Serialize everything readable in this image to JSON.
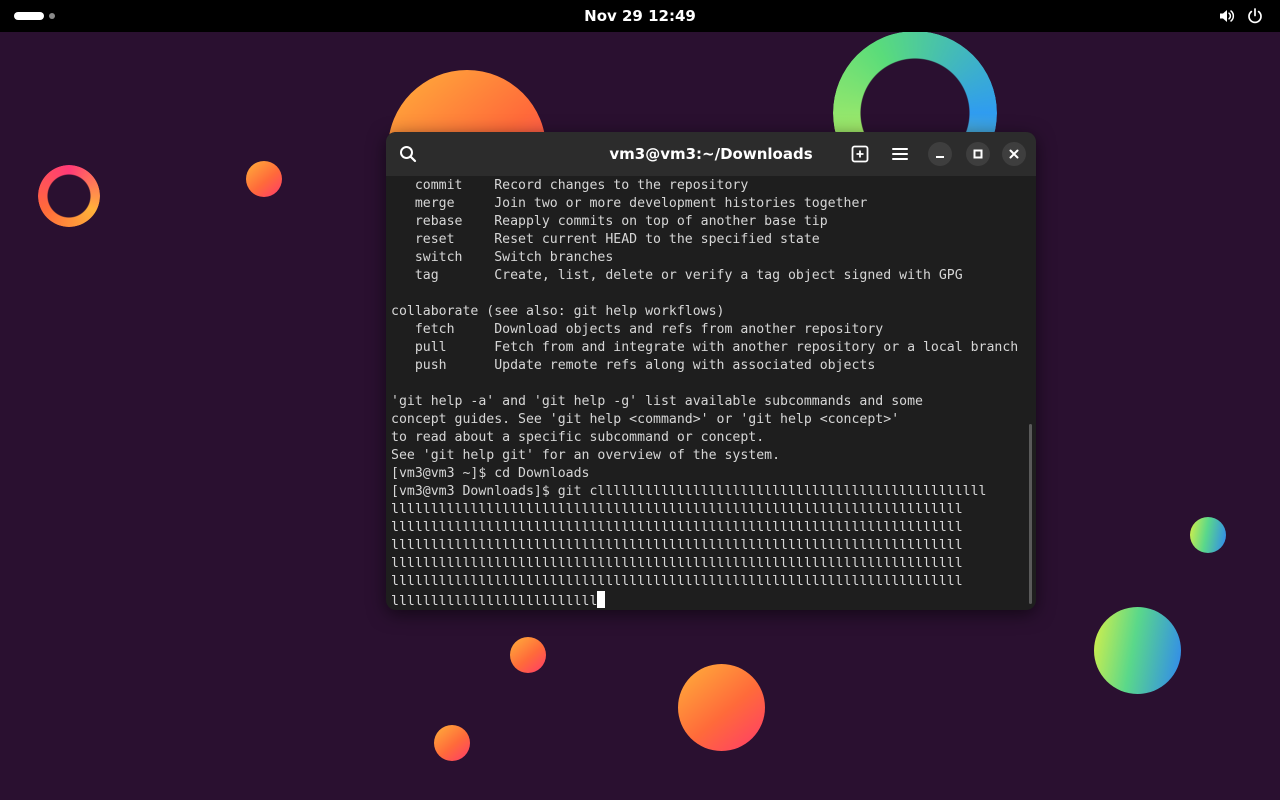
{
  "colors": {
    "desktop_bg": "#2a1030",
    "topbar_bg": "#000000",
    "terminal_bg": "#1e1e1e",
    "headerbar_bg": "#2c2c2c",
    "terminal_text": "#d6d6d6"
  },
  "topbar": {
    "clock": "Nov 29  12:49",
    "icons": [
      "activities-indicator",
      "volume-icon",
      "power-icon"
    ]
  },
  "terminal": {
    "title": "vm3@vm3:~/Downloads",
    "header_icons": [
      "search-icon",
      "new-tab-icon",
      "menu-icon",
      "minimize-icon",
      "maximize-icon",
      "close-icon"
    ],
    "lines": [
      "   commit    Record changes to the repository",
      "   merge     Join two or more development histories together",
      "   rebase    Reapply commits on top of another base tip",
      "   reset     Reset current HEAD to the specified state",
      "   switch    Switch branches",
      "   tag       Create, list, delete or verify a tag object signed with GPG",
      "",
      "collaborate (see also: git help workflows)",
      "   fetch     Download objects and refs from another repository",
      "   pull      Fetch from and integrate with another repository or a local branch",
      "   push      Update remote refs along with associated objects",
      "",
      "'git help -a' and 'git help -g' list available subcommands and some",
      "concept guides. See 'git help <command>' or 'git help <concept>'",
      "to read about a specific subcommand or concept.",
      "See 'git help git' for an overview of the system.",
      "[vm3@vm3 ~]$ cd Downloads",
      "[vm3@vm3 Downloads]$ git clllllllllllllllllllllllllllllllllllllllllllllllll",
      "llllllllllllllllllllllllllllllllllllllllllllllllllllllllllllllllllllllll",
      "llllllllllllllllllllllllllllllllllllllllllllllllllllllllllllllllllllllll",
      "llllllllllllllllllllllllllllllllllllllllllllllllllllllllllllllllllllllll",
      "llllllllllllllllllllllllllllllllllllllllllllllllllllllllllllllllllllllll",
      "llllllllllllllllllllllllllllllllllllllllllllllllllllllllllllllllllllllll",
      "llllllllllllllllllllllllll"
    ]
  }
}
